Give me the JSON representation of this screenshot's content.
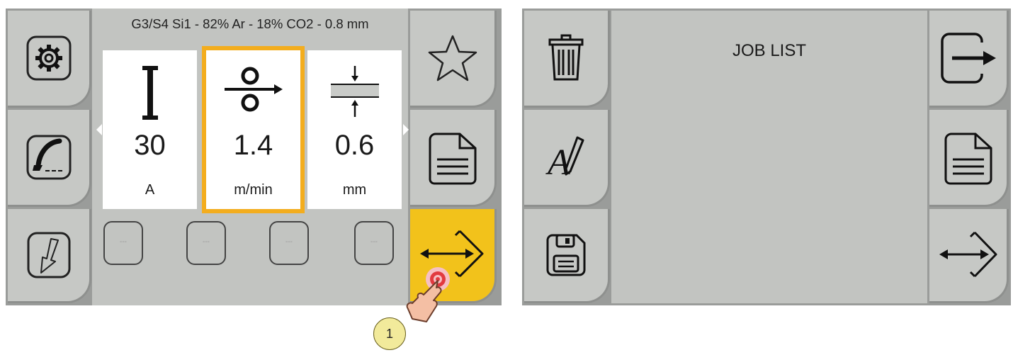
{
  "left_screen": {
    "header": "G3/S4 Si1 - 82% Ar - 18% CO2 - 0.8 mm",
    "left_buttons": [
      {
        "icon": "gear-icon"
      },
      {
        "icon": "welding-torch-icon"
      },
      {
        "icon": "torch-trigger-icon"
      }
    ],
    "parameters": [
      {
        "icon": "current-icon",
        "value": "30",
        "unit": "A",
        "selected": false
      },
      {
        "icon": "wire-feed-icon",
        "value": "1.4",
        "unit": "m/min",
        "selected": true
      },
      {
        "icon": "thickness-icon",
        "value": "0.6",
        "unit": "mm",
        "selected": false
      }
    ],
    "slots": [
      "---",
      "---",
      "---",
      "---"
    ],
    "right_buttons": [
      {
        "icon": "star-icon"
      },
      {
        "icon": "document-icon"
      },
      {
        "icon": "job-import-export-icon",
        "highlight": "#f2c21b"
      }
    ]
  },
  "right_screen": {
    "title": "JOB LIST",
    "left_buttons": [
      {
        "icon": "trash-icon"
      },
      {
        "icon": "rename-icon"
      },
      {
        "icon": "save-icon"
      }
    ],
    "right_buttons": [
      {
        "icon": "exit-icon"
      },
      {
        "icon": "document-icon"
      },
      {
        "icon": "job-import-export-icon"
      }
    ]
  },
  "callout": {
    "label": "1"
  },
  "colors": {
    "accent_yellow": "#f2c21b",
    "selected_border": "#f3ad1e",
    "panel_bg": "#c2c4c1"
  }
}
